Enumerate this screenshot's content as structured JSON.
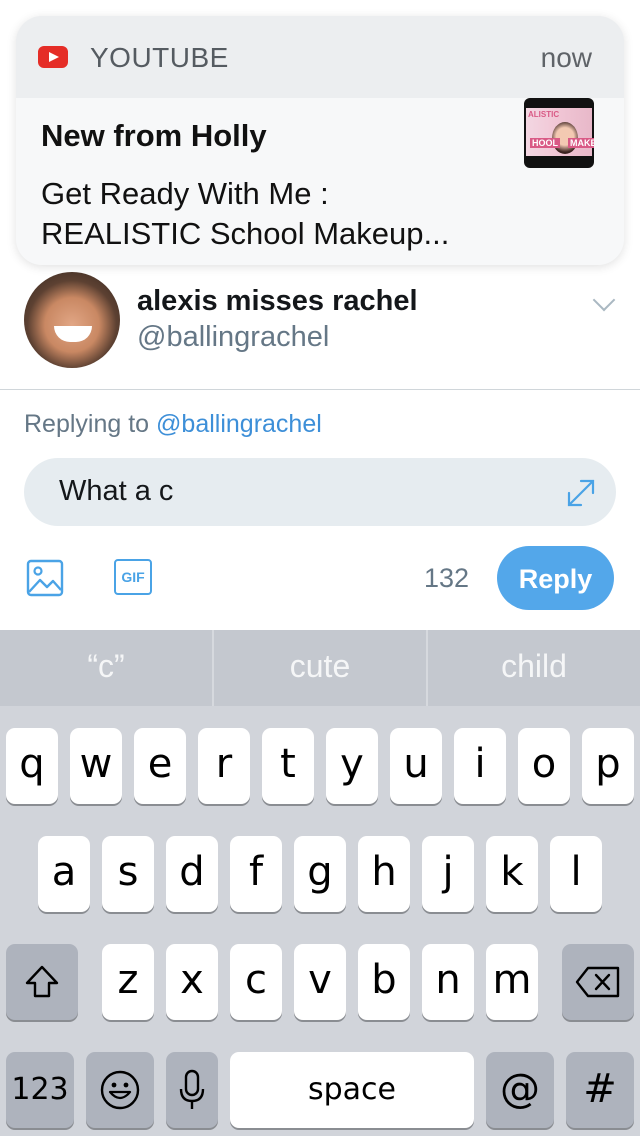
{
  "notification": {
    "app_name": "YOUTUBE",
    "time": "now",
    "title": "New from Holly",
    "line1": "Get Ready With Me :",
    "line2": "REALISTIC School Makeup...",
    "thumbnail_label_left": "HOOL",
    "thumbnail_label_right": "MAKE",
    "thumbnail_label_top": "ALISTIC"
  },
  "tweet": {
    "display_name": "alexis misses rachel",
    "handle": "@ballingrachel"
  },
  "reply": {
    "replying_prefix": "Replying to",
    "replying_handle": "@ballingrachel",
    "compose_text": "What a c",
    "char_count": "132",
    "reply_button": "Reply"
  },
  "keyboard": {
    "suggestions": [
      "“c”",
      "cute",
      "child"
    ],
    "row1": [
      "q",
      "w",
      "e",
      "r",
      "t",
      "y",
      "u",
      "i",
      "o",
      "p"
    ],
    "row2": [
      "a",
      "s",
      "d",
      "f",
      "g",
      "h",
      "j",
      "k",
      "l"
    ],
    "row3": [
      "z",
      "x",
      "c",
      "v",
      "b",
      "n",
      "m"
    ],
    "numbers_key": "123",
    "space_key": "space",
    "at_key": "@",
    "hash_key": "#"
  },
  "colors": {
    "accent": "#53a7ea",
    "youtube_red": "#e52d27",
    "keyboard_bg": "#d1d4da"
  }
}
